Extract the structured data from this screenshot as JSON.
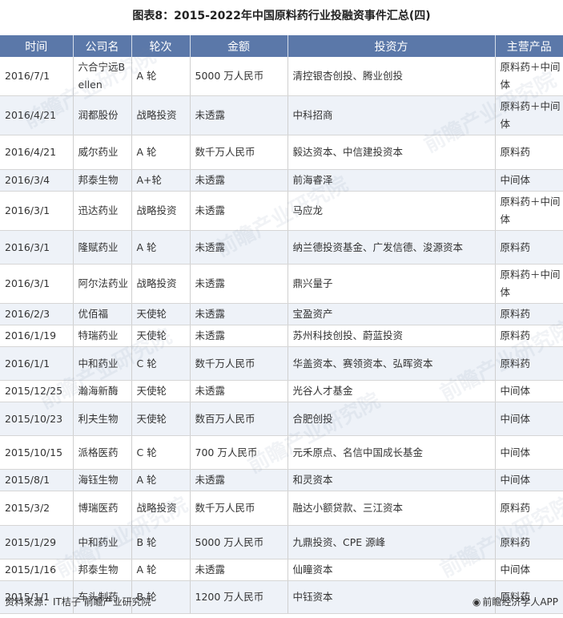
{
  "title": "图表8：2015-2022年中国原料药行业投融资事件汇总(四)",
  "headers": [
    "时间",
    "公司名",
    "轮次",
    "金额",
    "投资方",
    "主营产品"
  ],
  "rows": [
    [
      "2016/7/1",
      "六合宁远Bellen",
      "A 轮",
      "5000 万人民币",
      "清控银杏创投、腾业创投",
      "原料药＋中间体"
    ],
    [
      "2016/4/21",
      "润都股份",
      "战略投资",
      "未透露",
      "中科招商",
      "原料药＋中间体"
    ],
    [
      "2016/4/21",
      "威尔药业",
      "A 轮",
      "数千万人民币",
      "毅达资本、中信建投资本",
      "原料药"
    ],
    [
      "2016/3/4",
      "邦泰生物",
      "A+轮",
      "未透露",
      "前海睿泽",
      "中间体"
    ],
    [
      "2016/3/1",
      "迅达药业",
      "战略投资",
      "未透露",
      "马应龙",
      "原料药＋中间体"
    ],
    [
      "2016/3/1",
      "隆赋药业",
      "A 轮",
      "未透露",
      "纳兰德投资基金、广发信德、浚源资本",
      "原料药"
    ],
    [
      "2016/3/1",
      "阿尔法药业",
      "战略投资",
      "未透露",
      "鼎兴量子",
      "原料药＋中间体"
    ],
    [
      "2016/2/3",
      "优佰福",
      "天使轮",
      "未透露",
      "宝盈资产",
      "原料药"
    ],
    [
      "2016/1/19",
      "特瑞药业",
      "天使轮",
      "未透露",
      "苏州科技创投、蔚蓝投资",
      "原料药"
    ],
    [
      "2016/1/1",
      "中和药业",
      "C 轮",
      "数千万人民币",
      "华盖资本、赛领资本、弘晖资本",
      "原料药"
    ],
    [
      "2015/12/25",
      "瀚海新酶",
      "天使轮",
      "未透露",
      "光谷人才基金",
      "中间体"
    ],
    [
      "2015/10/23",
      "利夫生物",
      "天使轮",
      "数百万人民币",
      "合肥创投",
      "中间体"
    ],
    [
      "2015/10/15",
      "派格医药",
      "C 轮",
      "700 万人民币",
      "元禾原点、名信中国成长基金",
      "中间体"
    ],
    [
      "2015/8/1",
      "海钰生物",
      "A 轮",
      "未透露",
      "和灵资本",
      "中间体"
    ],
    [
      "2015/3/2",
      "博瑞医药",
      "战略投资",
      "数千万人民币",
      "融达小额贷款、三江资本",
      "原料药"
    ],
    [
      "2015/1/29",
      "中和药业",
      "B 轮",
      "5000 万人民币",
      "九鼎投资、CPE 源峰",
      "原料药"
    ],
    [
      "2015/1/16",
      "邦泰生物",
      "A 轮",
      "未透露",
      "仙瞳资本",
      "中间体"
    ],
    [
      "2015/1/1",
      "车头制药",
      "B 轮",
      "1200 万人民币",
      "中钰资本",
      "原料药"
    ]
  ],
  "row_heights": [],
  "source": "资料来源：IT桔子 前瞻产业研究院",
  "brand": "前瞻经济学人APP",
  "watermark": "前瞻产业研究院",
  "colors": {
    "header_bg": "#5b78a9",
    "stripe": "#eef2f8"
  }
}
